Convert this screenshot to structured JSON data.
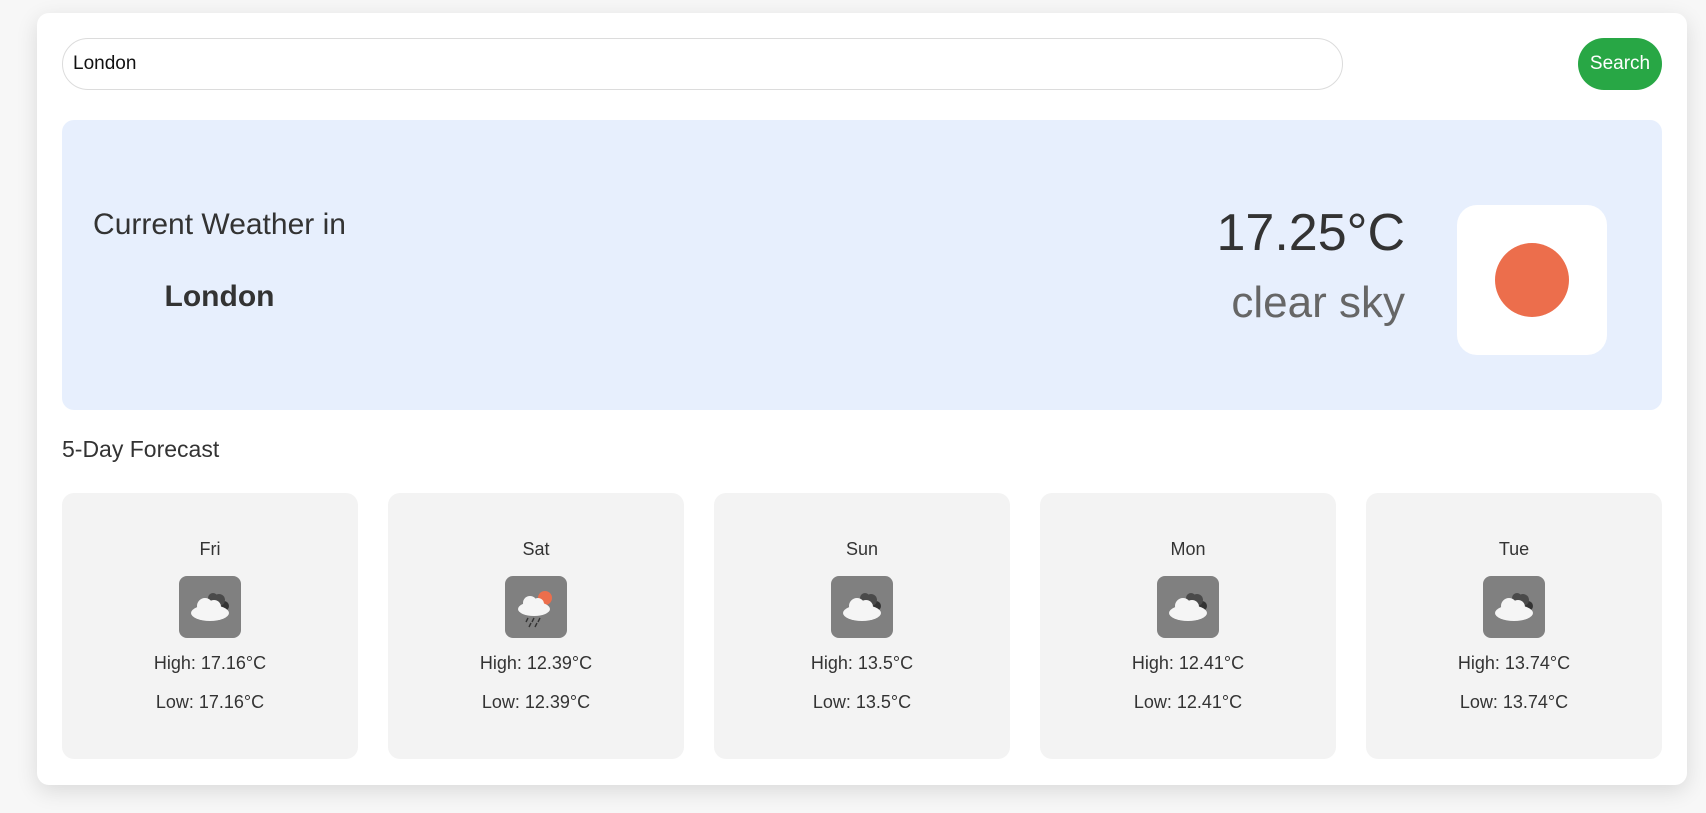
{
  "search": {
    "value": "London",
    "button_label": "Search"
  },
  "current": {
    "label": "Current Weather in",
    "city": "London",
    "temperature": "17.25°C",
    "description": "clear sky",
    "icon": "clear-sky-sun-icon"
  },
  "forecast": {
    "title": "5-Day Forecast",
    "days": [
      {
        "day": "Fri",
        "icon": "broken-clouds-icon",
        "high": "High: 17.16°C",
        "low": "Low: 17.16°C"
      },
      {
        "day": "Sat",
        "icon": "light-rain-icon",
        "high": "High: 12.39°C",
        "low": "Low: 12.39°C"
      },
      {
        "day": "Sun",
        "icon": "broken-clouds-icon",
        "high": "High: 13.5°C",
        "low": "Low: 13.5°C"
      },
      {
        "day": "Mon",
        "icon": "broken-clouds-icon",
        "high": "High: 12.41°C",
        "low": "Low: 12.41°C"
      },
      {
        "day": "Tue",
        "icon": "broken-clouds-icon",
        "high": "High: 13.74°C",
        "low": "Low: 13.74°C"
      }
    ]
  },
  "colors": {
    "accent_green": "#28a745",
    "current_bg": "#e7effd",
    "sun": "#ec6e4c",
    "card_bg": "#f3f3f3",
    "icon_bg": "#808080"
  }
}
